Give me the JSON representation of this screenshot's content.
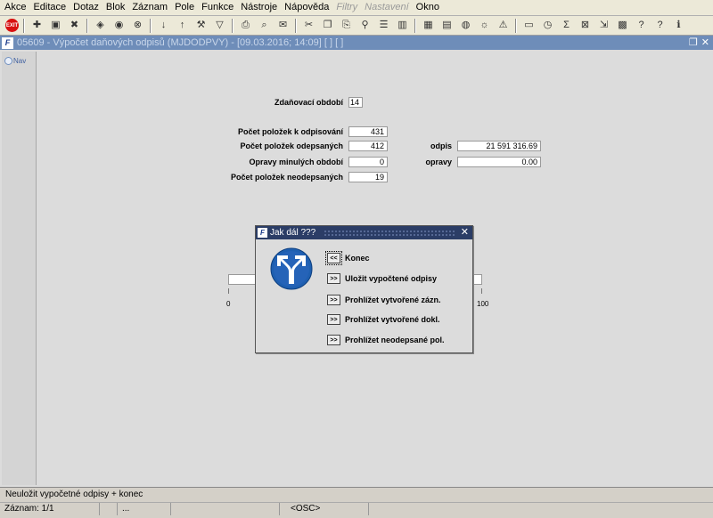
{
  "menu": {
    "items": [
      {
        "label": "Akce",
        "disabled": false
      },
      {
        "label": "Editace",
        "disabled": false
      },
      {
        "label": "Dotaz",
        "disabled": false
      },
      {
        "label": "Blok",
        "disabled": false
      },
      {
        "label": "Záznam",
        "disabled": false
      },
      {
        "label": "Pole",
        "disabled": false
      },
      {
        "label": "Funkce",
        "disabled": false
      },
      {
        "label": "Nástroje",
        "disabled": false
      },
      {
        "label": "Nápověda",
        "disabled": false
      },
      {
        "label": "Filtry",
        "disabled": true
      },
      {
        "label": "Nastavení",
        "disabled": true
      },
      {
        "label": "Okno",
        "disabled": false
      }
    ]
  },
  "window": {
    "title": "05609 - Výpočet daňových odpisů (MJDODPVY) - [09.03.2016; 14:09] [ ] [ ]",
    "nav_label": "Nav"
  },
  "form": {
    "period_label": "Zdaňovací období",
    "period_value": "14",
    "count_to_depreciate_label": "Počet položek k odpisování",
    "count_to_depreciate_value": "431",
    "count_depreciated_label": "Počet položek odepsaných",
    "count_depreciated_value": "412",
    "corrections_prev_label": "Opravy minulých období",
    "corrections_prev_value": "0",
    "count_not_depreciated_label": "Počet položek neodepsaných",
    "count_not_depreciated_value": "19",
    "depreciation_label": "odpis",
    "depreciation_value": "21 591 316.69",
    "corrections_label": "opravy",
    "corrections_value": "0.00"
  },
  "progress": {
    "min_label": "0",
    "max_label": "100",
    "fraction": 0.0
  },
  "dialog": {
    "title": "Jak dál ???",
    "options": [
      {
        "button": "<<",
        "label": "Konec"
      },
      {
        "button": ">>",
        "label": "Uložit vypočtené odpisy"
      },
      {
        "button": ">>",
        "label": "Prohlížet vytvořené zázn."
      },
      {
        "button": ">>",
        "label": "Prohlížet vytvořené dokl."
      },
      {
        "button": ">>",
        "label": "Prohlížet neodepsané pol."
      }
    ]
  },
  "status": {
    "message": "Neuložit vypočetné odpisy + konec",
    "record": "Záznam: 1/1",
    "cell3": "...",
    "mode": "<OSC>"
  }
}
